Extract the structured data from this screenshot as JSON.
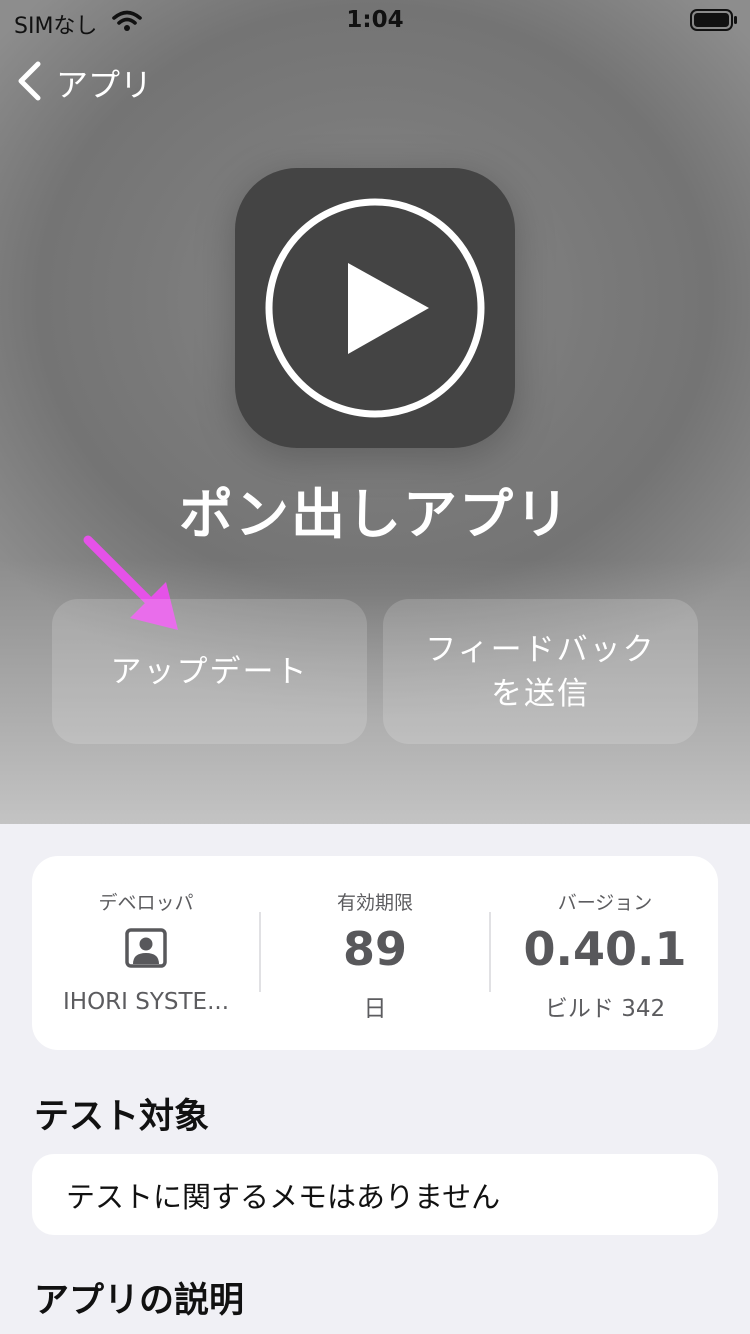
{
  "status_bar": {
    "carrier": "SIMなし",
    "time": "1:04"
  },
  "nav": {
    "back_label": "アプリ"
  },
  "app": {
    "name": "ポン出しアプリ",
    "icon": "play-circle-icon"
  },
  "actions": {
    "update_label": "アップデート",
    "feedback_line1": "フィードバック",
    "feedback_line2": "を送信"
  },
  "info": {
    "developer_label": "デベロッパ",
    "developer_icon": "person-badge-icon",
    "developer_name": "IHORI SYSTE...",
    "expiry_label": "有効期限",
    "expiry_value": "89",
    "expiry_unit": "日",
    "version_label": "バージョン",
    "version_value": "0.40.1",
    "build": "ビルド 342"
  },
  "test_section": {
    "title": "テスト対象",
    "note": "テストに関するメモはありません"
  },
  "description_section": {
    "title": "アプリの説明"
  },
  "colors": {
    "annotation_arrow": "#e552e8",
    "app_icon_bg": "#444444"
  }
}
